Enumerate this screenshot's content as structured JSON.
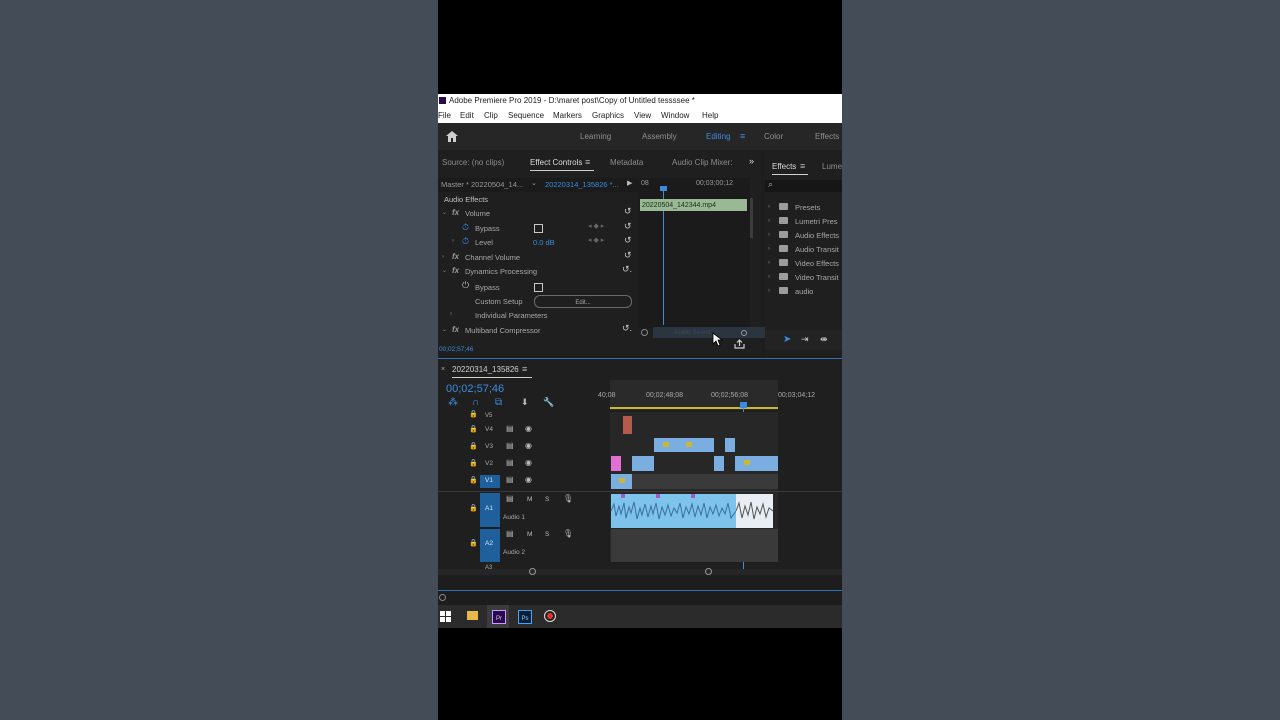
{
  "window": {
    "title": "Adobe Premiere Pro 2019 - D:\\maret post\\Copy of Untitled tessssee *"
  },
  "menu": [
    "File",
    "Edit",
    "Clip",
    "Sequence",
    "Markers",
    "Graphics",
    "View",
    "Window",
    "Help"
  ],
  "workspaces": {
    "learning": "Learning",
    "assembly": "Assembly",
    "editing": "Editing",
    "color": "Color",
    "effects": "Effects"
  },
  "source_panel": {
    "tabs": {
      "source": "Source: (no clips)",
      "effect_controls": "Effect Controls",
      "metadata": "Metadata",
      "audio_clip_mixer": "Audio Clip Mixer:"
    },
    "master_label": "Master * 20220504_14...",
    "sequence_label": "20220314_135826 *...",
    "ruler_start": "08",
    "ruler_time": "00;03;00;12",
    "clip_name": "20220504_142344.mp4",
    "section": "Audio Effects",
    "volume": "Volume",
    "bypass": "Bypass",
    "level": "Level",
    "level_value": "0.0 dB",
    "channel_volume": "Channel Volume",
    "dynamics": "Dynamics Processing",
    "bypass2": "Bypass",
    "custom_setup": "Custom Setup",
    "edit_button": "Edit...",
    "individual": "Individual Parameters",
    "multiband": "Multiband Compressor",
    "footer_time": "00;02;57;46",
    "audio_select": "Audio Select"
  },
  "effects_panel": {
    "tabs": {
      "effects": "Effects",
      "lumetri": "Lume"
    },
    "items": [
      "Presets",
      "Lumetri Pres",
      "Audio Effects",
      "Audio Transit",
      "Video Effects",
      "Video Transit",
      "audio"
    ]
  },
  "timeline": {
    "sequence_name": "20220314_135826",
    "timecode": "00;02;57;46",
    "ruler": [
      "40;08",
      "00;02;48;08",
      "00;02;56;08",
      "00;03;04;12"
    ],
    "tracks": [
      {
        "id": "V5"
      },
      {
        "id": "V4"
      },
      {
        "id": "V3"
      },
      {
        "id": "V2"
      },
      {
        "id": "V1"
      },
      {
        "id": "A1",
        "name": "Audio 1"
      },
      {
        "id": "A2",
        "name": "Audio 2"
      },
      {
        "id": "A3"
      }
    ],
    "m_label": "M",
    "s_label": "S",
    "fx_label": "fx"
  },
  "taskbar": {
    "premiere": "Pr",
    "photoshop": "Ps"
  },
  "colors": {
    "accent": "#2f7fe0",
    "audio_clip": "#7dc3ec",
    "video_clip": "#7aaee0",
    "pink_clip": "#e26fd2"
  }
}
